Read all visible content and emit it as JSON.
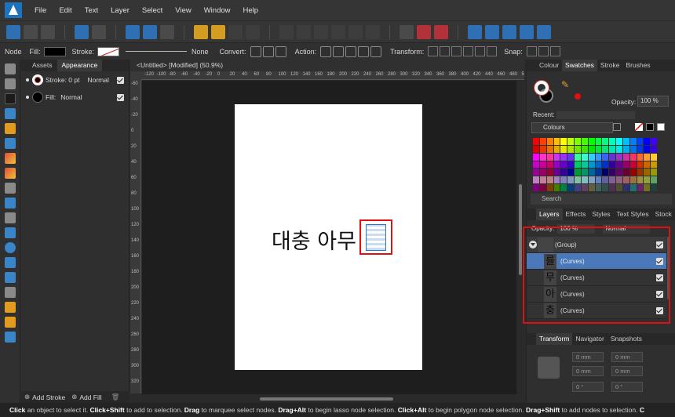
{
  "menubar": {
    "items": [
      "File",
      "Edit",
      "Text",
      "Layer",
      "Select",
      "View",
      "Window",
      "Help"
    ]
  },
  "context_toolbar": {
    "node_label": "Node",
    "fill_label": "Fill:",
    "stroke_label": "Stroke:",
    "stroke_value": "None",
    "convert_label": "Convert:",
    "action_label": "Action:",
    "transform_label": "Transform:",
    "snap_label": "Snap:"
  },
  "left_panel": {
    "tabs": [
      "Assets",
      "Appearance"
    ],
    "active_tab": "Appearance",
    "stroke_row": {
      "label": "Stroke: 0 pt",
      "blend": "Normal"
    },
    "fill_row": {
      "label": "Fill:",
      "blend": "Normal"
    },
    "footer": {
      "add_stroke": "Add Stroke",
      "add_fill": "Add Fill"
    }
  },
  "document": {
    "tab_title": "<Untitled> [Modified] (50.9%)",
    "canvas_text": "대충 아무",
    "ruler_h": [
      "-120",
      "-100",
      "-80",
      "-60",
      "-40",
      "-20",
      "0",
      "20",
      "40",
      "60",
      "80",
      "100",
      "120",
      "140",
      "160",
      "180",
      "200",
      "220",
      "240",
      "260",
      "280",
      "300",
      "320",
      "340",
      "360",
      "380",
      "400",
      "420",
      "440",
      "460",
      "480",
      "500"
    ],
    "ruler_v": [
      "-60",
      "-40",
      "-20",
      "0",
      "20",
      "40",
      "60",
      "80",
      "100",
      "120",
      "140",
      "160",
      "180",
      "200",
      "220",
      "240",
      "260",
      "280",
      "300",
      "320"
    ]
  },
  "right_panel": {
    "tabs": [
      "Colour",
      "Swatches",
      "Stroke",
      "Brushes"
    ],
    "active_tab": "Swatches",
    "opacity_label": "Opacity:",
    "opacity_value": "100 %",
    "recent_label": "Recent:",
    "palette_name": "Colours",
    "search_placeholder": "Search",
    "swatch_colors": [
      "#ff0000",
      "#ff4000",
      "#ff8000",
      "#ffbf00",
      "#ffff00",
      "#bfff00",
      "#80ff00",
      "#40ff00",
      "#00ff00",
      "#00ff40",
      "#00ff80",
      "#00ffbf",
      "#00ffff",
      "#00bfff",
      "#0080ff",
      "#0040ff",
      "#0000ff",
      "#4000ff",
      "#e00000",
      "#e63900",
      "#e67300",
      "#e6ac00",
      "#e6e600",
      "#ace600",
      "#73e600",
      "#39e600",
      "#00e600",
      "#00e639",
      "#00e673",
      "#00e6ac",
      "#00e6e6",
      "#00ace6",
      "#0073e6",
      "#0039e6",
      "#0000e6",
      "#3900e6",
      "#ff00ff",
      "#ff33cc",
      "#ff3399",
      "#cc33ff",
      "#9933ff",
      "#6633ff",
      "#33ff99",
      "#33ffcc",
      "#33ccff",
      "#3399ff",
      "#3366ff",
      "#6633cc",
      "#9933cc",
      "#cc3399",
      "#ff3366",
      "#ff6633",
      "#ff9933",
      "#ffcc33",
      "#cc00cc",
      "#cc0099",
      "#cc0066",
      "#9900cc",
      "#6600cc",
      "#3300cc",
      "#00cc66",
      "#00cc99",
      "#0099cc",
      "#0066cc",
      "#0033cc",
      "#330099",
      "#660099",
      "#990066",
      "#cc0033",
      "#cc3300",
      "#cc6600",
      "#cc9900",
      "#990099",
      "#990066",
      "#990033",
      "#660099",
      "#330099",
      "#000099",
      "#009933",
      "#009966",
      "#006699",
      "#003399",
      "#000066",
      "#330066",
      "#660066",
      "#660033",
      "#990000",
      "#993300",
      "#996600",
      "#999900",
      "#c080c0",
      "#c08099",
      "#c08080",
      "#a080c0",
      "#8080c0",
      "#8099c0",
      "#80c0a0",
      "#80c0c0",
      "#80a0c0",
      "#6080c0",
      "#6060a0",
      "#806090",
      "#906080",
      "#a06060",
      "#a07040",
      "#a09040",
      "#90a040",
      "#60a060",
      "#800080",
      "#800040",
      "#804000",
      "#408000",
      "#008040",
      "#004080",
      "#404080",
      "#604060",
      "#606040",
      "#406060",
      "#305050",
      "#503050",
      "#505030",
      "#303070",
      "#207070",
      "#702070",
      "#707020",
      "#204040"
    ],
    "layers": {
      "tabs": [
        "Layers",
        "Effects",
        "Styles",
        "Text Styles",
        "Stock"
      ],
      "active_tab": "Layers",
      "opacity_label": "Opacity:",
      "opacity_value": "100 %",
      "blend_value": "Normal",
      "rows": [
        {
          "label": "(Group)",
          "thumb": "",
          "selected": false,
          "group": true
        },
        {
          "label": "(Curves)",
          "thumb": "를",
          "selected": true,
          "group": false
        },
        {
          "label": "(Curves)",
          "thumb": "무",
          "selected": false,
          "group": false
        },
        {
          "label": "(Curves)",
          "thumb": "아",
          "selected": false,
          "group": false
        },
        {
          "label": "(Curves)",
          "thumb": "충",
          "selected": false,
          "group": false
        }
      ]
    },
    "transform": {
      "tabs": [
        "Transform",
        "Navigator",
        "Snapshots"
      ],
      "active_tab": "Transform",
      "x": "0 mm",
      "y": "0 mm",
      "w": "0 mm",
      "h": "0 mm",
      "r": "0 °",
      "s": "0 °"
    }
  },
  "statusbar": {
    "segments": [
      {
        "bold": "Click",
        "text": " an object to select it. "
      },
      {
        "bold": "Click+Shift",
        "text": " to add to selection. "
      },
      {
        "bold": "Drag",
        "text": " to marquee select nodes. "
      },
      {
        "bold": "Drag+Alt",
        "text": " to begin lasso node selection. "
      },
      {
        "bold": "Click+Alt",
        "text": " to begin polygon node selection. "
      },
      {
        "bold": "Drag+Shift",
        "text": " to add nodes to selection. "
      },
      {
        "bold": "C",
        "text": ""
      }
    ]
  }
}
